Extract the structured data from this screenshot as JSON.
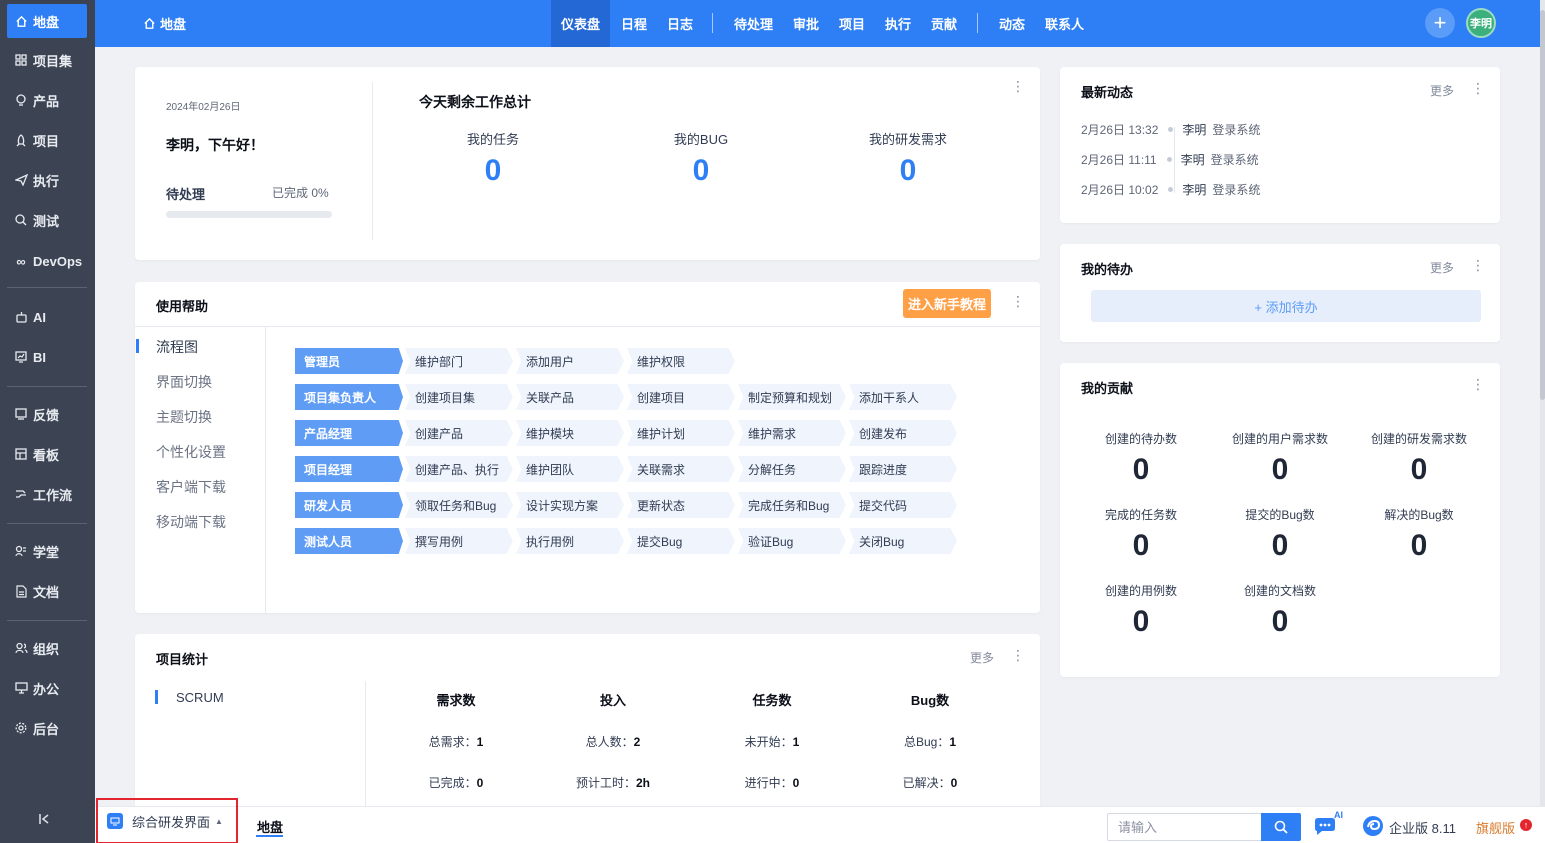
{
  "sidebar": {
    "items": [
      {
        "label": "地盘",
        "icon": "home-icon"
      },
      {
        "label": "项目集",
        "icon": "grid-icon"
      },
      {
        "label": "产品",
        "icon": "bulb-icon"
      },
      {
        "label": "项目",
        "icon": "rocket-icon"
      },
      {
        "label": "执行",
        "icon": "send-icon"
      },
      {
        "label": "测试",
        "icon": "test-icon"
      },
      {
        "label": "DevOps",
        "icon": "infinity-icon"
      },
      {
        "label": "AI",
        "icon": "robot-icon"
      },
      {
        "label": "BI",
        "icon": "chart-icon"
      },
      {
        "label": "反馈",
        "icon": "feedback-icon"
      },
      {
        "label": "看板",
        "icon": "kanban-icon"
      },
      {
        "label": "工作流",
        "icon": "workflow-icon"
      },
      {
        "label": "学堂",
        "icon": "school-icon"
      },
      {
        "label": "文档",
        "icon": "doc-icon"
      },
      {
        "label": "组织",
        "icon": "users-icon"
      },
      {
        "label": "办公",
        "icon": "office-icon"
      },
      {
        "label": "后台",
        "icon": "gear-icon"
      }
    ],
    "collapse_icon": "collapse-icon"
  },
  "header": {
    "home": "地盘",
    "nav": [
      "仪表盘",
      "日程",
      "日志",
      "待处理",
      "审批",
      "项目",
      "执行",
      "贡献",
      "动态",
      "联系人"
    ],
    "avatar": "李明"
  },
  "welcome": {
    "date": "2024年02月26日",
    "greeting": "李明，下午好！",
    "pending": "待处理",
    "done": "已完成 0%",
    "progress": 0,
    "today_title": "今天剩余工作总计",
    "stats": [
      {
        "label": "我的任务",
        "value": "0"
      },
      {
        "label": "我的BUG",
        "value": "0"
      },
      {
        "label": "我的研发需求",
        "value": "0"
      }
    ]
  },
  "help": {
    "title": "使用帮助",
    "tutorial": "进入新手教程",
    "menu": [
      "流程图",
      "界面切换",
      "主题切换",
      "个性化设置",
      "客户端下载",
      "移动端下载"
    ],
    "flows": [
      {
        "role": "管理员",
        "steps": [
          "维护部门",
          "添加用户",
          "维护权限"
        ]
      },
      {
        "role": "项目集负责人",
        "steps": [
          "创建项目集",
          "关联产品",
          "创建项目",
          "制定预算和规划",
          "添加干系人"
        ]
      },
      {
        "role": "产品经理",
        "steps": [
          "创建产品",
          "维护模块",
          "维护计划",
          "维护需求",
          "创建发布"
        ]
      },
      {
        "role": "项目经理",
        "steps": [
          "创建产品、执行",
          "维护团队",
          "关联需求",
          "分解任务",
          "跟踪进度"
        ]
      },
      {
        "role": "研发人员",
        "steps": [
          "领取任务和Bug",
          "设计实现方案",
          "更新状态",
          "完成任务和Bug",
          "提交代码"
        ]
      },
      {
        "role": "测试人员",
        "steps": [
          "撰写用例",
          "执行用例",
          "提交Bug",
          "验证Bug",
          "关闭Bug"
        ]
      }
    ]
  },
  "project_stats": {
    "title": "项目统计",
    "more": "更多",
    "tab": "SCRUM",
    "columns": [
      {
        "head": "需求数",
        "lines": [
          {
            "k": "总需求：",
            "v": "1"
          },
          {
            "k": "已完成：",
            "v": "0"
          }
        ]
      },
      {
        "head": "投入",
        "lines": [
          {
            "k": "总人数：",
            "v": "2"
          },
          {
            "k": "预计工时：",
            "v": "2h"
          }
        ]
      },
      {
        "head": "任务数",
        "lines": [
          {
            "k": "未开始：",
            "v": "1"
          },
          {
            "k": "进行中：",
            "v": "0"
          }
        ]
      },
      {
        "head": "Bug数",
        "lines": [
          {
            "k": "总Bug：",
            "v": "1"
          },
          {
            "k": "已解决：",
            "v": "0"
          }
        ]
      }
    ]
  },
  "dynamics": {
    "title": "最新动态",
    "more": "更多",
    "items": [
      {
        "time": "2月26日 13:32",
        "who": "李明",
        "action": "登录系统"
      },
      {
        "time": "2月26日 11:11",
        "who": "李明",
        "action": "登录系统"
      },
      {
        "time": "2月26日 10:02",
        "who": "李明",
        "action": "登录系统"
      }
    ]
  },
  "todo": {
    "title": "我的待办",
    "more": "更多",
    "add": "+ 添加待办"
  },
  "contribution": {
    "title": "我的贡献",
    "items": [
      {
        "label": "创建的待办数",
        "value": "0"
      },
      {
        "label": "创建的用户需求数",
        "value": "0"
      },
      {
        "label": "创建的研发需求数",
        "value": "0"
      },
      {
        "label": "完成的任务数",
        "value": "0"
      },
      {
        "label": "提交的Bug数",
        "value": "0"
      },
      {
        "label": "解决的Bug数",
        "value": "0"
      },
      {
        "label": "创建的用例数",
        "value": "0"
      },
      {
        "label": "创建的文档数",
        "value": "0"
      }
    ]
  },
  "bottom": {
    "mode": "综合研发界面",
    "tab": "地盘",
    "search_placeholder": "请输入",
    "ai_badge": "AI",
    "edition": "企业版 8.11",
    "flagship": "旗舰版"
  },
  "colors": {
    "accent": "#2e7ff5",
    "sidebar": "#3c4353",
    "tutorial": "#ff9f46",
    "highlight": "#e3262d"
  }
}
